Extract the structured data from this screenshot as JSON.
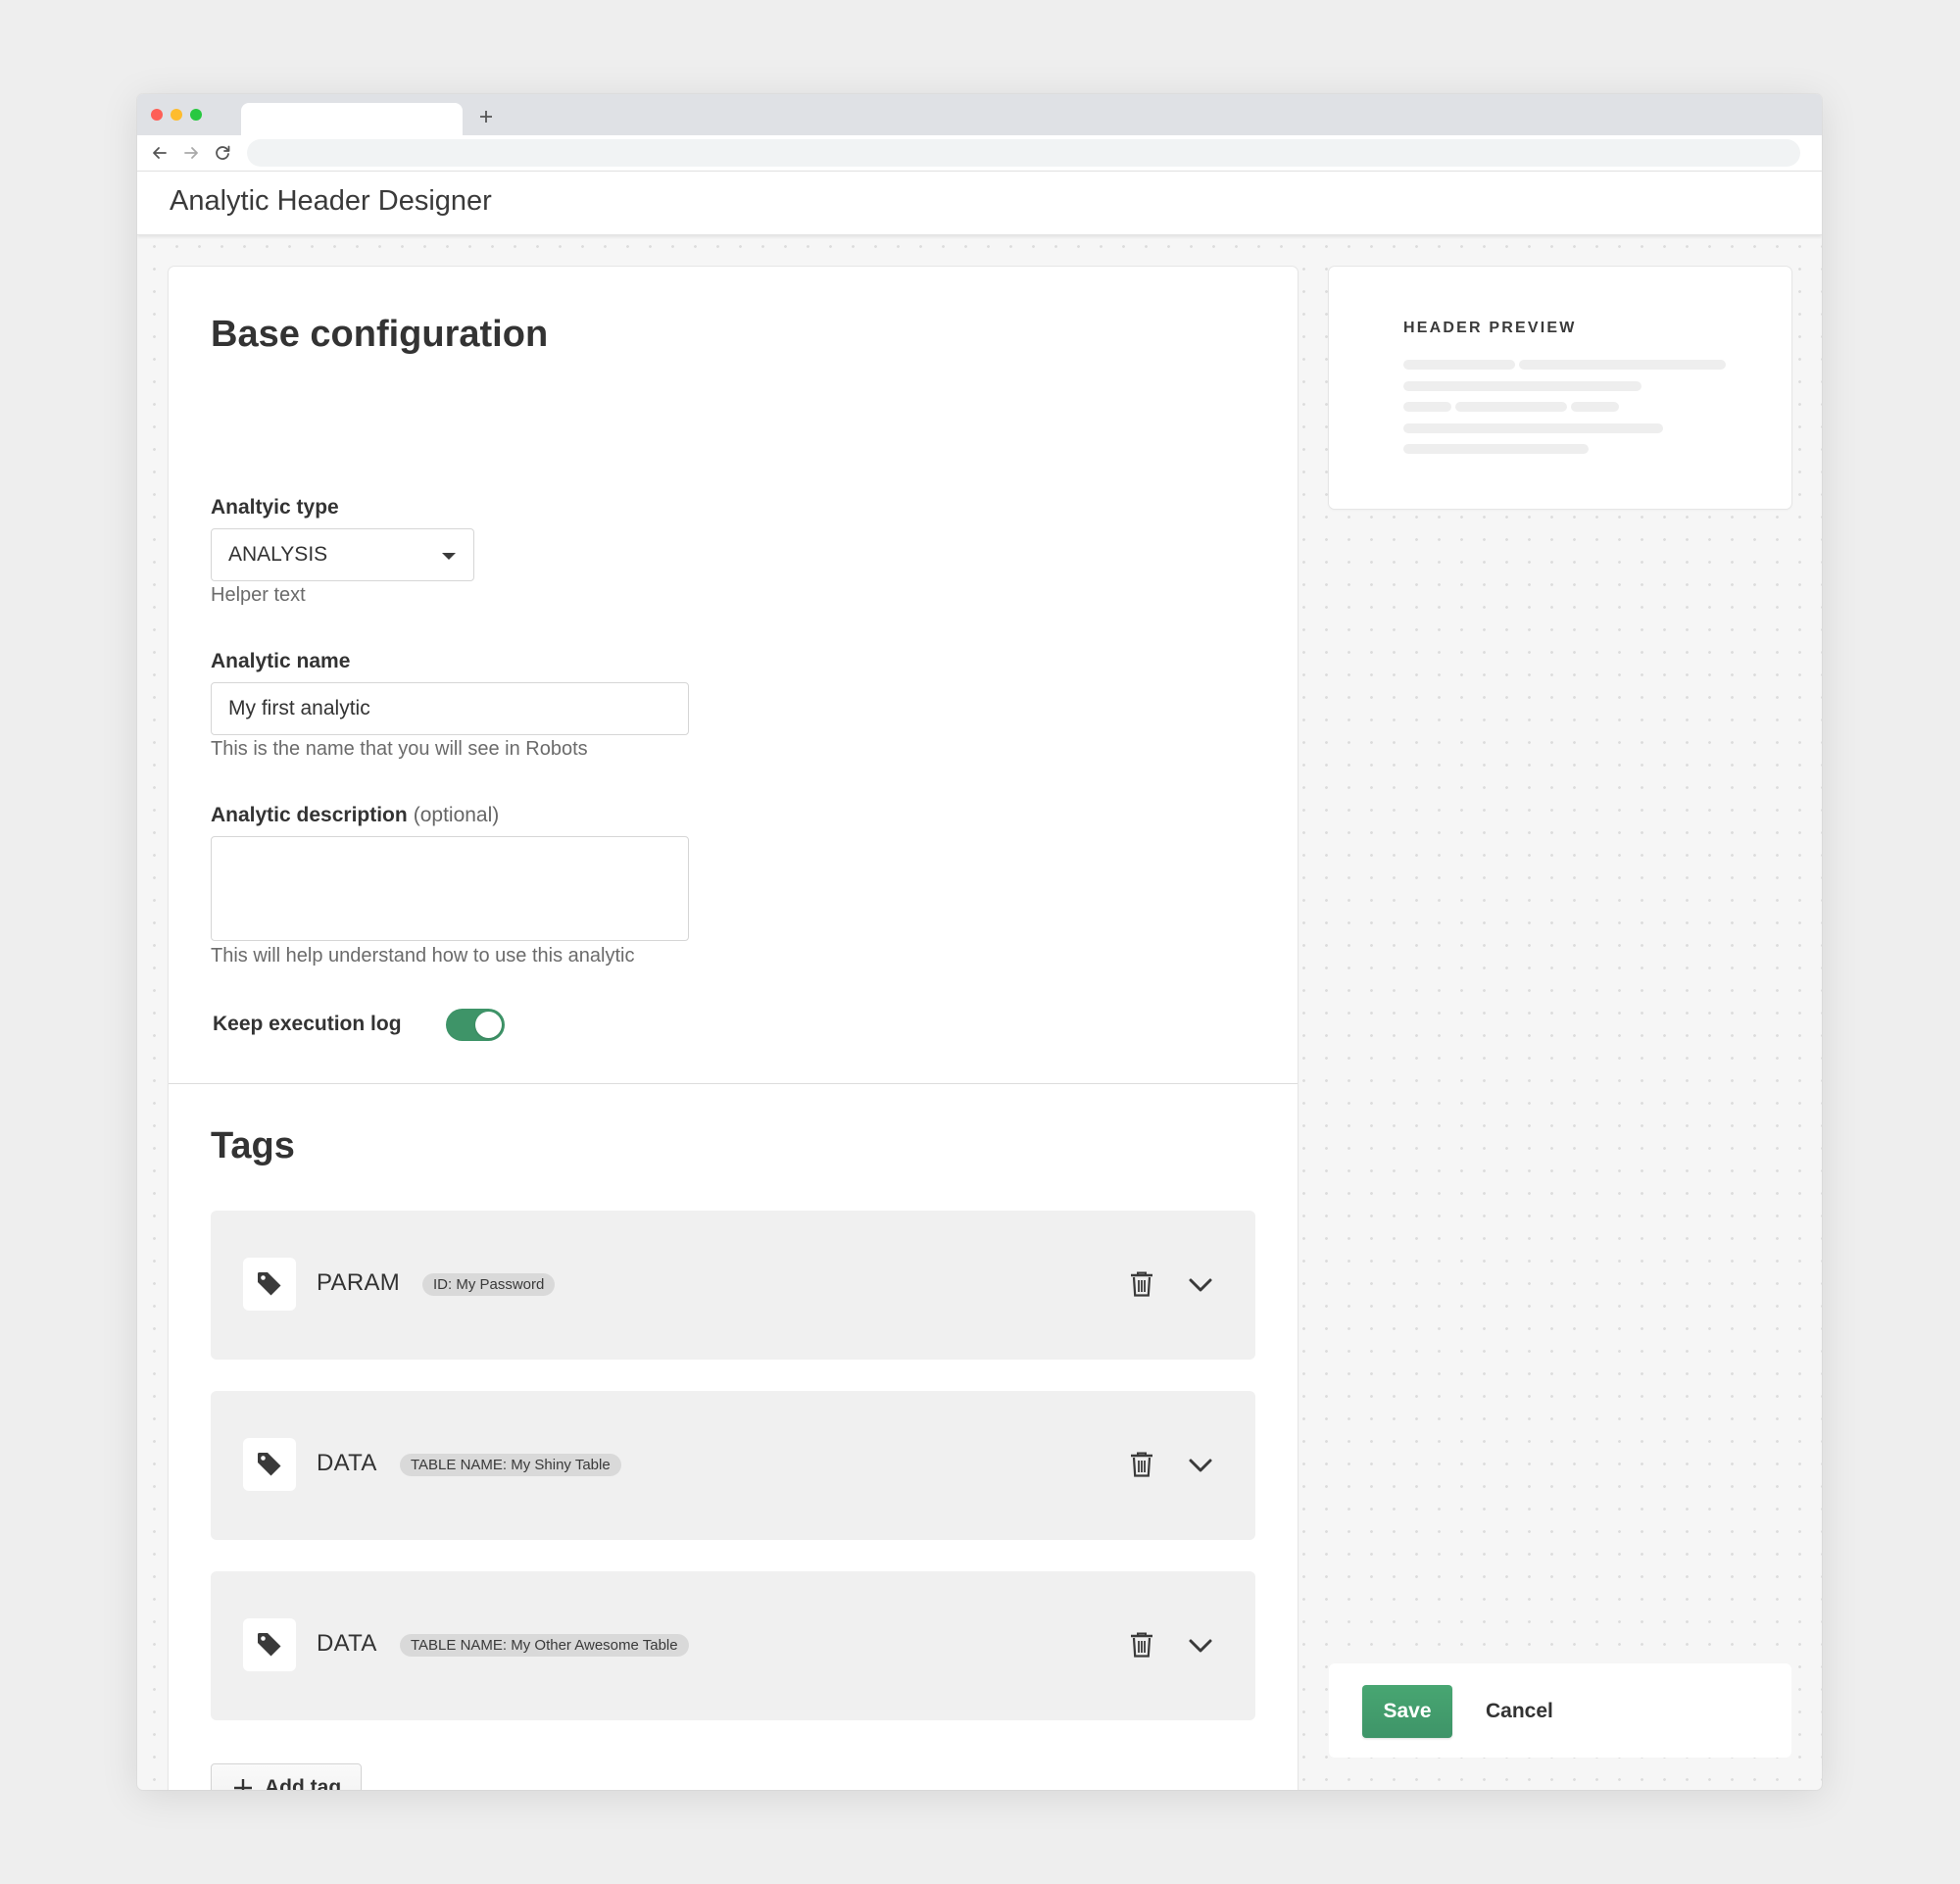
{
  "browser": {
    "new_tab_label": "+",
    "icons": {
      "back": "arrow-left-icon",
      "forward": "arrow-right-icon",
      "reload": "reload-icon",
      "new_tab": "plus-icon"
    }
  },
  "app": {
    "title": "Analytic Header Designer"
  },
  "base_config": {
    "title": "Base configuration",
    "analytic_type": {
      "label": "Analtyic type",
      "value": "ANALYSIS",
      "helper": "Helper text"
    },
    "analytic_name": {
      "label": "Analytic name",
      "value": "My first analytic",
      "helper": "This is the name that you will see in Robots"
    },
    "analytic_description": {
      "label": "Analytic description",
      "optional_label": "(optional)",
      "value": "",
      "helper": "This will help understand how to use this analytic"
    },
    "keep_execution_log": {
      "label": "Keep execution log",
      "enabled": true
    }
  },
  "tags": {
    "title": "Tags",
    "items": [
      {
        "type": "PARAM",
        "chip": "ID: My Password",
        "icon": "tag-icon"
      },
      {
        "type": "DATA",
        "chip": "TABLE NAME: My Shiny Table",
        "icon": "tag-icon"
      },
      {
        "type": "DATA",
        "chip": "TABLE NAME: My Other Awesome Table",
        "icon": "tag-icon"
      }
    ],
    "add_label": "Add tag"
  },
  "preview": {
    "title": "HEADER PREVIEW"
  },
  "actions": {
    "save_label": "Save",
    "cancel_label": "Cancel"
  },
  "colors": {
    "accent_green": "#3e9468",
    "tag_row_bg": "#f0f0f0",
    "chip_bg": "#d9d9d9",
    "page_bg": "#f6f6f6"
  }
}
